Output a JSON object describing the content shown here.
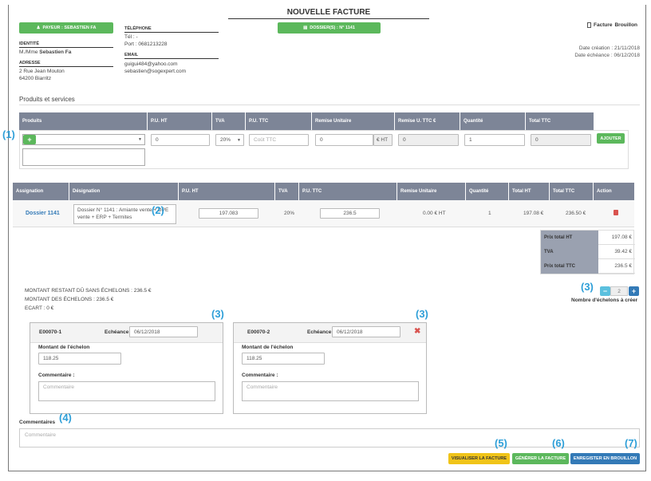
{
  "header": {
    "payer_button": "PAYEUR : SEBASTIEN FA",
    "dossier_button": "DOSSIER(S) : N° 1141",
    "title": "NOUVELLE FACTURE",
    "doc_type_label": "Facture",
    "doc_state": "Brouillon",
    "date_creation": "Date création : 21/11/2018",
    "date_echeance": "Date échéance : 06/12/2018"
  },
  "identity": {
    "identite_label": "IDENTITÉ",
    "name_prefix": "M./Mme",
    "name": "Sebastien Fa",
    "adresse_label": "ADRESSE",
    "address_line1": "2 Rue Jean Mouton",
    "address_line2": "64200 Biarritz",
    "telephone_label": "TÉLÉPHONE",
    "tel": "Tél : -",
    "port": "Port : 0681213228",
    "email_label": "EMAIL",
    "email1": "guigui484@yahoo.com",
    "email2": "sebastien@sogexpert.com"
  },
  "products_section": {
    "title": "Produits et services",
    "headers": [
      "Produits",
      "P.U. HT",
      "TVA",
      "P.U. TTC",
      "Remise Unitaire",
      "Remise U. TTC €",
      "Quantité",
      "Total TTC"
    ],
    "add_icon": "plus-icon",
    "pu_ht_value": "0",
    "tva_value": "20%",
    "pu_ttc_placeholder": "Coût TTC",
    "remise_value": "0",
    "remise_unit": "€ HT",
    "remise_ttc_value": "0",
    "quantite_value": "1",
    "total_value": "0",
    "ajouter_label": "AJOUTER"
  },
  "lines_table": {
    "headers": [
      "Assignation",
      "Désignation",
      "P.U. HT",
      "TVA",
      "P.U. TTC",
      "Remise Unitaire",
      "Quantité",
      "Total HT",
      "Total TTC",
      "Action"
    ],
    "row": {
      "assignation": "Dossier 1141",
      "designation": "Dossier N° 1141 : Amiante vente + DPE vente + ERP + Termites",
      "pu_ht": "197.083",
      "tva": "20%",
      "pu_ttc": "236.5",
      "remise": "0.00 € HT",
      "quantite": "1",
      "total_ht": "197.08 €",
      "total_ttc": "236.50 €",
      "action_icon": "trash-icon"
    }
  },
  "totals": {
    "prix_ht_label": "Prix total HT",
    "prix_ht_value": "197.08 €",
    "tva_label": "TVA",
    "tva_value": "39.42 €",
    "prix_ttc_label": "Prix total TTC",
    "prix_ttc_value": "236.5 €"
  },
  "echelons": {
    "montant_restant": "MONTANT RESTANT DÛ SANS ÉCHELONS : 236.5 €",
    "montant_echelons": "MONTANT DES ÉCHELONS : 236.5 €",
    "ecart": "ECART : 0 €",
    "count": "2",
    "count_label": "Nombre d'échelons à créer",
    "minus_icon": "minus-icon",
    "plus_icon": "plus-icon",
    "cards": [
      {
        "code": "E00070-1",
        "echeance_label": "Echéance",
        "echeance": "06/12/2018",
        "montant_label": "Montant de l'échelon",
        "montant": "118.25",
        "commentaire_label": "Commentaire :",
        "commentaire_placeholder": "Commentaire"
      },
      {
        "code": "E00070-2",
        "echeance_label": "Echéance",
        "echeance": "06/12/2018",
        "montant_label": "Montant de l'échelon",
        "montant": "118.25",
        "commentaire_label": "Commentaire :",
        "commentaire_placeholder": "Commentaire",
        "remove_icon": "close-icon"
      }
    ]
  },
  "commentaires": {
    "label": "Commentaires",
    "placeholder": "Commentaire"
  },
  "footer": {
    "visualiser": "VISUALISER LA FACTURE",
    "generer": "GÉNÉRER LA FACTURE",
    "enregistrer": "ENREGISTER EN BROUILLON"
  },
  "annotations": [
    "(1)",
    "(2)",
    "(3)",
    "(3)",
    "(3)",
    "(4)",
    "(5)",
    "(6)",
    "(7)"
  ],
  "colors": {
    "green": "#5cb85c",
    "blue": "#337ab7",
    "yellow": "#f0ad4e",
    "header_gray": "#7d8597",
    "annotation": "#2e9fd8",
    "red": "#d9534f"
  }
}
